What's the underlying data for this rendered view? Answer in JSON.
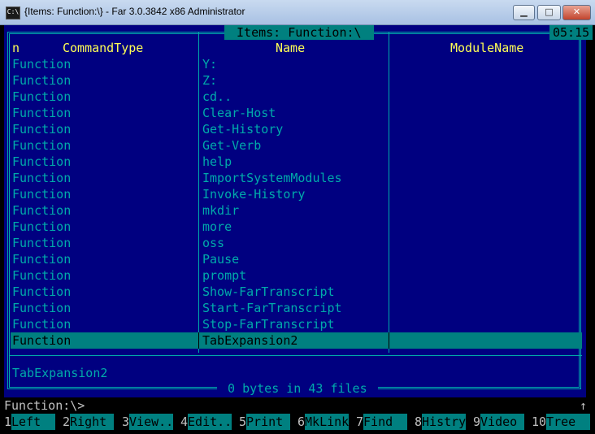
{
  "window": {
    "title": "{Items: Function:\\} - Far 3.0.3842 x86 Administrator",
    "icon_text": "C:\\",
    "minimize_glyph": "▁",
    "maximize_glyph": "□",
    "close_glyph": "✕"
  },
  "panel": {
    "title": " Items: Function:\\ ",
    "clock": "05:15",
    "headers": {
      "n": "n",
      "command_type": "CommandType",
      "name": "Name",
      "module_name": "ModuleName"
    },
    "rows": [
      {
        "type": "Function",
        "name": "Y:"
      },
      {
        "type": "Function",
        "name": "Z:"
      },
      {
        "type": "Function",
        "name": "cd.."
      },
      {
        "type": "Function",
        "name": "Clear-Host"
      },
      {
        "type": "Function",
        "name": "Get-History"
      },
      {
        "type": "Function",
        "name": "Get-Verb"
      },
      {
        "type": "Function",
        "name": "help"
      },
      {
        "type": "Function",
        "name": "ImportSystemModules"
      },
      {
        "type": "Function",
        "name": "Invoke-History"
      },
      {
        "type": "Function",
        "name": "mkdir"
      },
      {
        "type": "Function",
        "name": "more"
      },
      {
        "type": "Function",
        "name": "oss"
      },
      {
        "type": "Function",
        "name": "Pause"
      },
      {
        "type": "Function",
        "name": "prompt"
      },
      {
        "type": "Function",
        "name": "Show-FarTranscript"
      },
      {
        "type": "Function",
        "name": "Start-FarTranscript"
      },
      {
        "type": "Function",
        "name": "Stop-FarTranscript"
      },
      {
        "type": "Function",
        "name": "TabExpansion2"
      }
    ],
    "selected_index": 17,
    "status_line": "TabExpansion2",
    "summary": " 0 bytes in 43 files "
  },
  "command_line": {
    "prompt": "Function:\\>",
    "scroll_glyph": "↑"
  },
  "keybar": [
    {
      "num": "1",
      "label": "Left  "
    },
    {
      "num": "2",
      "label": "Right "
    },
    {
      "num": "3",
      "label": "View.."
    },
    {
      "num": "4",
      "label": "Edit.."
    },
    {
      "num": "5",
      "label": "Print "
    },
    {
      "num": "6",
      "label": "MkLink"
    },
    {
      "num": "7",
      "label": "Find  "
    },
    {
      "num": "8",
      "label": "Histry"
    },
    {
      "num": "9",
      "label": "Video "
    },
    {
      "num": "10",
      "label": "Tree  "
    }
  ],
  "colors": {
    "panel_bg": "#000080",
    "panel_text": "#00aaaa",
    "header_text": "#ffff55",
    "highlight_bg": "#008080"
  }
}
